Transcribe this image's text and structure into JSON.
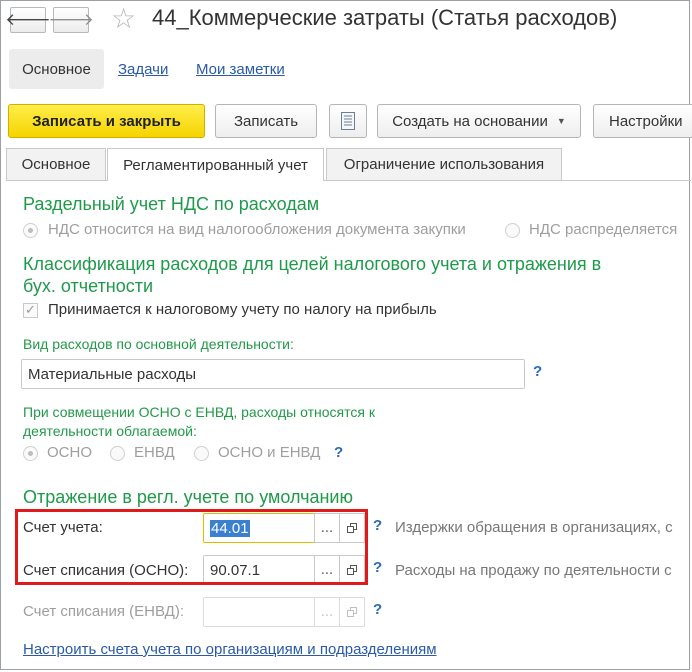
{
  "window": {
    "title": "44_Коммерческие затраты (Статья расходов)"
  },
  "section_nav": {
    "active": "Основное",
    "links": [
      "Задачи",
      "Мои заметки"
    ]
  },
  "toolbar": {
    "save_close": "Записать и закрыть",
    "save": "Записать",
    "create_based_on": "Создать на основании",
    "settings": "Настройки"
  },
  "tabs": [
    "Основное",
    "Регламентированный учет",
    "Ограничение использования"
  ],
  "vat": {
    "heading": "Раздельный учет НДС по расходам",
    "options": [
      "НДС относится на вид налогообложения документа закупки",
      "НДС распределяется"
    ]
  },
  "classification": {
    "heading": "Классификация расходов для целей налогового учета и отражения в бух. отчетности",
    "heading_line1": "Классификация расходов для целей налогового учета и отражения в",
    "heading_line2": "бух. отчетности",
    "checkbox_label": "Принимается к налоговому учету по налогу на прибыль",
    "expense_type_label": "Вид расходов по основной деятельности:",
    "expense_type_value": "Материальные расходы",
    "combined_label": "При совмещении ОСНО с ЕНВД, расходы относятся к деятельности облагаемой:",
    "combined_label_line1": "При совмещении ОСНО с ЕНВД, расходы относятся к",
    "combined_label_line2": "деятельности облагаемой:",
    "combined_options": [
      "ОСНО",
      "ЕНВД",
      "ОСНО и ЕНВД"
    ]
  },
  "reflection": {
    "heading": "Отражение в регл. учете по умолчанию",
    "account_label": "Счет учета:",
    "account_value": "44.01",
    "account_desc": "Издержки обращения в организациях, с",
    "writeoff_osno_label": "Счет списания (ОСНО):",
    "writeoff_osno_value": "90.07.1",
    "writeoff_osno_desc": "Расходы на продажу по деятельности с",
    "writeoff_envd_label": "Счет списания (ЕНВД):",
    "writeoff_envd_value": "",
    "setup_link": "Настроить счета учета по организациям и подразделениям"
  },
  "glyphs": {
    "back": "🡐",
    "forward": "🡒",
    "star": "☆",
    "check": "✓",
    "help": "?",
    "select": "...",
    "caret": "▼"
  },
  "colors": {
    "accent_green": "#1f9a4b",
    "primary_button": "#f5d400",
    "link": "#2a5aa8",
    "highlight_box": "#e01a1a"
  }
}
